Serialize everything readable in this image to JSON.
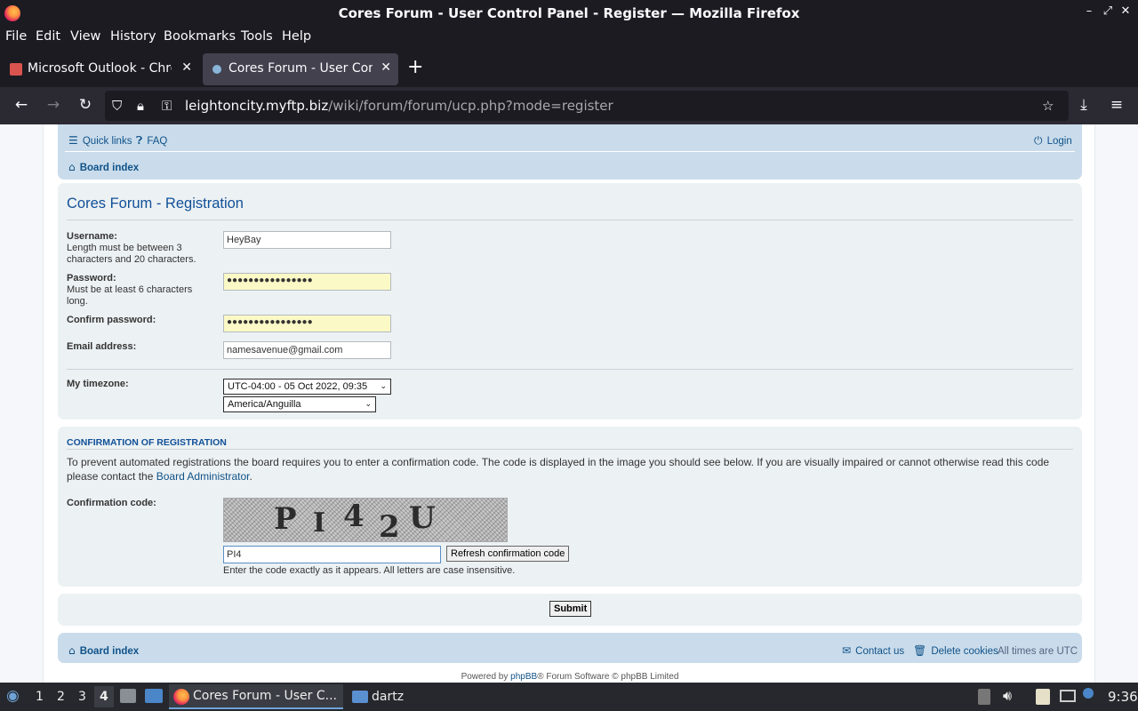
{
  "window": {
    "title": "Cores Forum - User Control Panel - Register — Mozilla Firefox"
  },
  "menu": [
    "File",
    "Edit",
    "View",
    "History",
    "Bookmarks",
    "Tools",
    "Help"
  ],
  "tabs": [
    {
      "label": "Microsoft Outlook - Chrome"
    },
    {
      "label": "Cores Forum - User Control Panel"
    }
  ],
  "urlbar": {
    "host": "leightoncity.myftp.biz",
    "path": "/wiki/forum/forum/ucp.php?mode=register"
  },
  "header": {
    "quick_links": "Quick links",
    "faq": "FAQ",
    "login": "Login",
    "board_index": "Board index"
  },
  "registration": {
    "title": "Cores Forum - Registration",
    "username_label": "Username:",
    "username_hint": "Length must be between 3 characters and 20 characters.",
    "username_value": "HeyBay",
    "password_label": "Password:",
    "password_hint": "Must be at least 6 characters long.",
    "password_value": "●●●●●●●●●●●●●●●●",
    "confirm_label": "Confirm password:",
    "confirm_value": "●●●●●●●●●●●●●●●●",
    "email_label": "Email address:",
    "email_value": "namesavenue@gmail.com",
    "timezone_label": "My timezone:",
    "timezone_value": "UTC-04:00 - 05 Oct 2022, 09:35",
    "timezone_region": "America/Anguilla"
  },
  "confirmation": {
    "heading": "CONFIRMATION OF REGISTRATION",
    "text": "To prevent automated registrations the board requires you to enter a confirmation code. The code is displayed in the image you should see below. If you are visually impaired or cannot otherwise read this code please contact the ",
    "admin_link": "Board Administrator",
    "text_end": ".",
    "code_label": "Confirmation code:",
    "captcha_chars": [
      "P",
      "I",
      "4",
      "2",
      "U"
    ],
    "code_value": "PI4",
    "refresh_label": "Refresh confirmation code",
    "note": "Enter the code exactly as it appears. All letters are case insensitive."
  },
  "submit_label": "Submit",
  "footer": {
    "board_index": "Board index",
    "contact": "Contact us",
    "delete_cookies": "Delete cookies",
    "times": "All times are UTC",
    "powered_pre": "Powered by ",
    "powered_link": "phpBB",
    "powered_post": "® Forum Software © phpBB Limited"
  },
  "taskbar": {
    "workspaces": [
      "1",
      "2",
      "3",
      "4"
    ],
    "active_task": "Cores Forum - User C...",
    "folder_task": "dartz",
    "clock": "9:36"
  },
  "colors": {
    "accent_link": "#105289",
    "header_bg": "#cadceb",
    "panel_bg": "#ecf1f3"
  }
}
